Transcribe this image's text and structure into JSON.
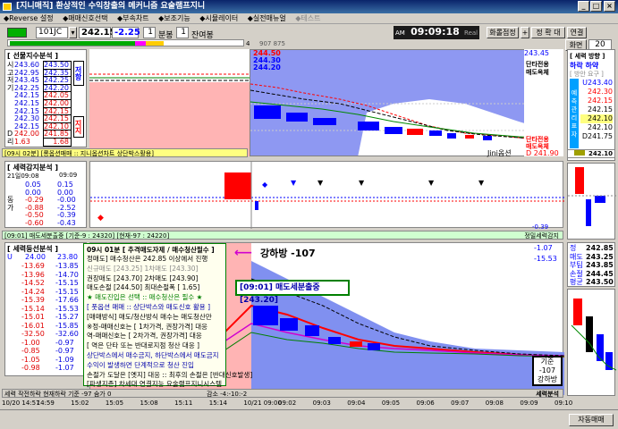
{
  "window": {
    "title": "[지니매직] 환상적인 수익창출의 메커니즘 요술램프지니",
    "min": "_",
    "max": "□",
    "close": "×"
  },
  "menu": [
    "◆Reverse 설정",
    "◆매매신호선택",
    "◆부속차트",
    "◆보조기능",
    "◆시뮬레이터",
    "◆실전매뉴얼",
    "◆테스트"
  ],
  "toolbar": {
    "code": "101JC",
    "price": "242.15",
    "change": "-2.25",
    "period_value": "1",
    "period_unit": "분봉",
    "rest_value": "1",
    "rest_unit": "잔여봉",
    "ampm": "AM",
    "clock": "09:09:18",
    "real": "Real",
    "clock_unit": "초",
    "window_btn": "화롤점정",
    "plus": "+",
    "zoom": "정 확 대",
    "link": "연결",
    "screen_label": "화면",
    "screen_no": "20",
    "sub_val1": "4",
    "sub_val2": "907 875"
  },
  "ls_top": {
    "header": "[ 선물지수분석 ]",
    "side": "저항",
    "side2": "지지",
    "rows": [
      {
        "k": "시",
        "a": "243.60",
        "b": "243.50"
      },
      {
        "k": "고",
        "a": "242.95",
        "b": "242.35"
      },
      {
        "k": "저",
        "a": "243.45",
        "b": "242.25"
      },
      {
        "k": "기",
        "a": "242.25",
        "b": "242.20"
      },
      {
        "k": "",
        "a": "242.15",
        "b": "242.05"
      },
      {
        "k": "",
        "a": "242.15",
        "b": "242.00"
      },
      {
        "k": "",
        "a": "242.15",
        "b": "242.15"
      },
      {
        "k": "",
        "a": "242.30",
        "b": "242.15"
      },
      {
        "k": "",
        "a": "242.15",
        "b": "242.10"
      },
      {
        "k": "D",
        "a": "242.00",
        "b": "241.85"
      },
      {
        "k": "리",
        "a": "1.63",
        "b": "1.68"
      }
    ],
    "footer": "[09시 02분]  [롱옵션매매 :: 지니옵션차트 상단박스활용]"
  },
  "top_chart": {
    "price_labels": [
      "244.50",
      "244.30",
      "244.20"
    ],
    "label_jini": "Jini옵션",
    "ymax": "243.45",
    "ylabels": [
      "D 241.90"
    ],
    "sig_text": [
      "단타전용",
      "매도옥체"
    ],
    "sig_text2": [
      "단타전용",
      "매도옥체"
    ]
  },
  "right_top": {
    "header": "[ 세력 방향 ]",
    "dir": "하락 하약",
    "sub": "[ 방안 요구 ]",
    "prices": [
      "U243.40",
      "242.30",
      "242.15",
      "242.15",
      "242.10",
      "242.10",
      "D241.75"
    ],
    "vert": "예 측 관 리 표 자",
    "bottom": "242.10"
  },
  "ls_mid": {
    "header": "[ 세력감지분석 ]",
    "time1": "21일09:08",
    "time2": "09:09",
    "rows": [
      {
        "k": "",
        "a": "0.05",
        "b": "0.15"
      },
      {
        "k": "",
        "a": "0.00",
        "b": "0.00"
      },
      {
        "k": "동",
        "a": "-0.29",
        "b": "-0.00"
      },
      {
        "k": "가",
        "a": "-0.88",
        "b": "-2.52"
      },
      {
        "k": "",
        "a": "-0.50",
        "b": "-0.39"
      },
      {
        "k": "",
        "a": "-0.60",
        "b": "-0.43"
      }
    ],
    "footer": "[09:01] 매도세분출중 [기준-9 : 24320]  [현재-97 : 24220]",
    "right_label": "정밀세력감지",
    "val": "-0.39"
  },
  "ls_bot": {
    "header": "[ 세력등선분석 ]",
    "col1": "U",
    "col2": "24.00",
    "col3": "23.80",
    "rows": [
      {
        "k": "",
        "a": "-13.69",
        "b": "-13.85"
      },
      {
        "k": "",
        "a": "-13.96",
        "b": "-14.70"
      },
      {
        "k": "",
        "a": "-14.52",
        "b": "-15.15"
      },
      {
        "k": "",
        "a": "-14.24",
        "b": "-15.15"
      },
      {
        "k": "",
        "a": "-15.39",
        "b": "-17.66"
      },
      {
        "k": "",
        "a": "-15.14",
        "b": "-15.53"
      },
      {
        "k": "",
        "a": "-15.01",
        "b": "-15.27"
      },
      {
        "k": "",
        "a": "-16.01",
        "b": "-15.85"
      },
      {
        "k": "",
        "a": "-32.50",
        "b": "-32.60"
      },
      {
        "k": "",
        "a": "-1.00",
        "b": "-0.97"
      },
      {
        "k": "",
        "a": "-0.85",
        "b": "-0.97"
      },
      {
        "k": "",
        "a": "-1.05",
        "b": "-1.09"
      },
      {
        "k": "",
        "a": "-0.98",
        "b": "-1.07"
      }
    ]
  },
  "msgbox": {
    "title": "09시 01분  [ 추격매도자제 / 매수청산필수 ]",
    "lines": [
      "정매도] 매수청산은 242.85 이상에서 진행",
      "신규매도 [243.25]       1차매도 [243.30]",
      "권장매도 [243.70]       2차매도 [243.90]",
      "매도손절 [244.50]       최대손절폭 [ 1.65]",
      "★ 매도진입은 선택  ::  매수청산은 필수 ★",
      "[ 풋옵션 매매 :: 상단박스와 매도신호 활용 ]",
      "[매매방식] 매도/청산방식 매수는 매도청산만",
      "※정-매매신호는 [ 1차가격, 권장가격] 대응",
      "역-매매신호는 [ 2차가격, 권장가격] 대응",
      "[ 역은 단타 또는 반대로지점 청산 대응 ]",
      "상단박스에서 매수금지, 하단박스에서 매도금지",
      "수익이 발생하면 단계적으로 청산 진입",
      "손절가 도달은 [옛지] 대응 :: 최후의 손절은 [반대신호발생]",
      "[파생지존] 차세대 연결지능 요술램프지니시스템"
    ]
  },
  "annot": {
    "arrow_text": "강하방 -107",
    "box_text": "[09:01] 매도세분출중[243.20]",
    "right_box1": "기준",
    "right_box2": "-107",
    "right_box3": "강하방"
  },
  "bot_chart": {
    "labels": [
      "-1.07",
      "-15.53"
    ],
    "right_label": "세력분석",
    "below": "세력 작전하락 현재하락 기준 -97 숨가 0",
    "below2": "감소 -4:-10:-2",
    "price": "0"
  },
  "right_bot": {
    "rows": [
      {
        "k": "정",
        "v": "242.85"
      },
      {
        "k": "매도",
        "v": "243.25"
      },
      {
        "k": "부팀",
        "v": "243.85"
      },
      {
        "k": "손절",
        "v": "244.45"
      },
      {
        "k": "평균",
        "v": "243.50"
      }
    ]
  },
  "time_axis": [
    "10/20 14:57",
    "14:59",
    "15:02",
    "15:05",
    "15:08",
    "15:11",
    "15:14",
    "10/21 09:00",
    "09:02",
    "09:03",
    "09:04",
    "09:05",
    "09:06",
    "09:07",
    "09:08",
    "09:09",
    "09:10"
  ],
  "status": {
    "btn": "자동매매"
  },
  "colors": {
    "red": "#ff0000",
    "blue": "#0000ff",
    "pink": "#ffb4b4",
    "green": "#00a000",
    "purple": "#cc00cc"
  }
}
